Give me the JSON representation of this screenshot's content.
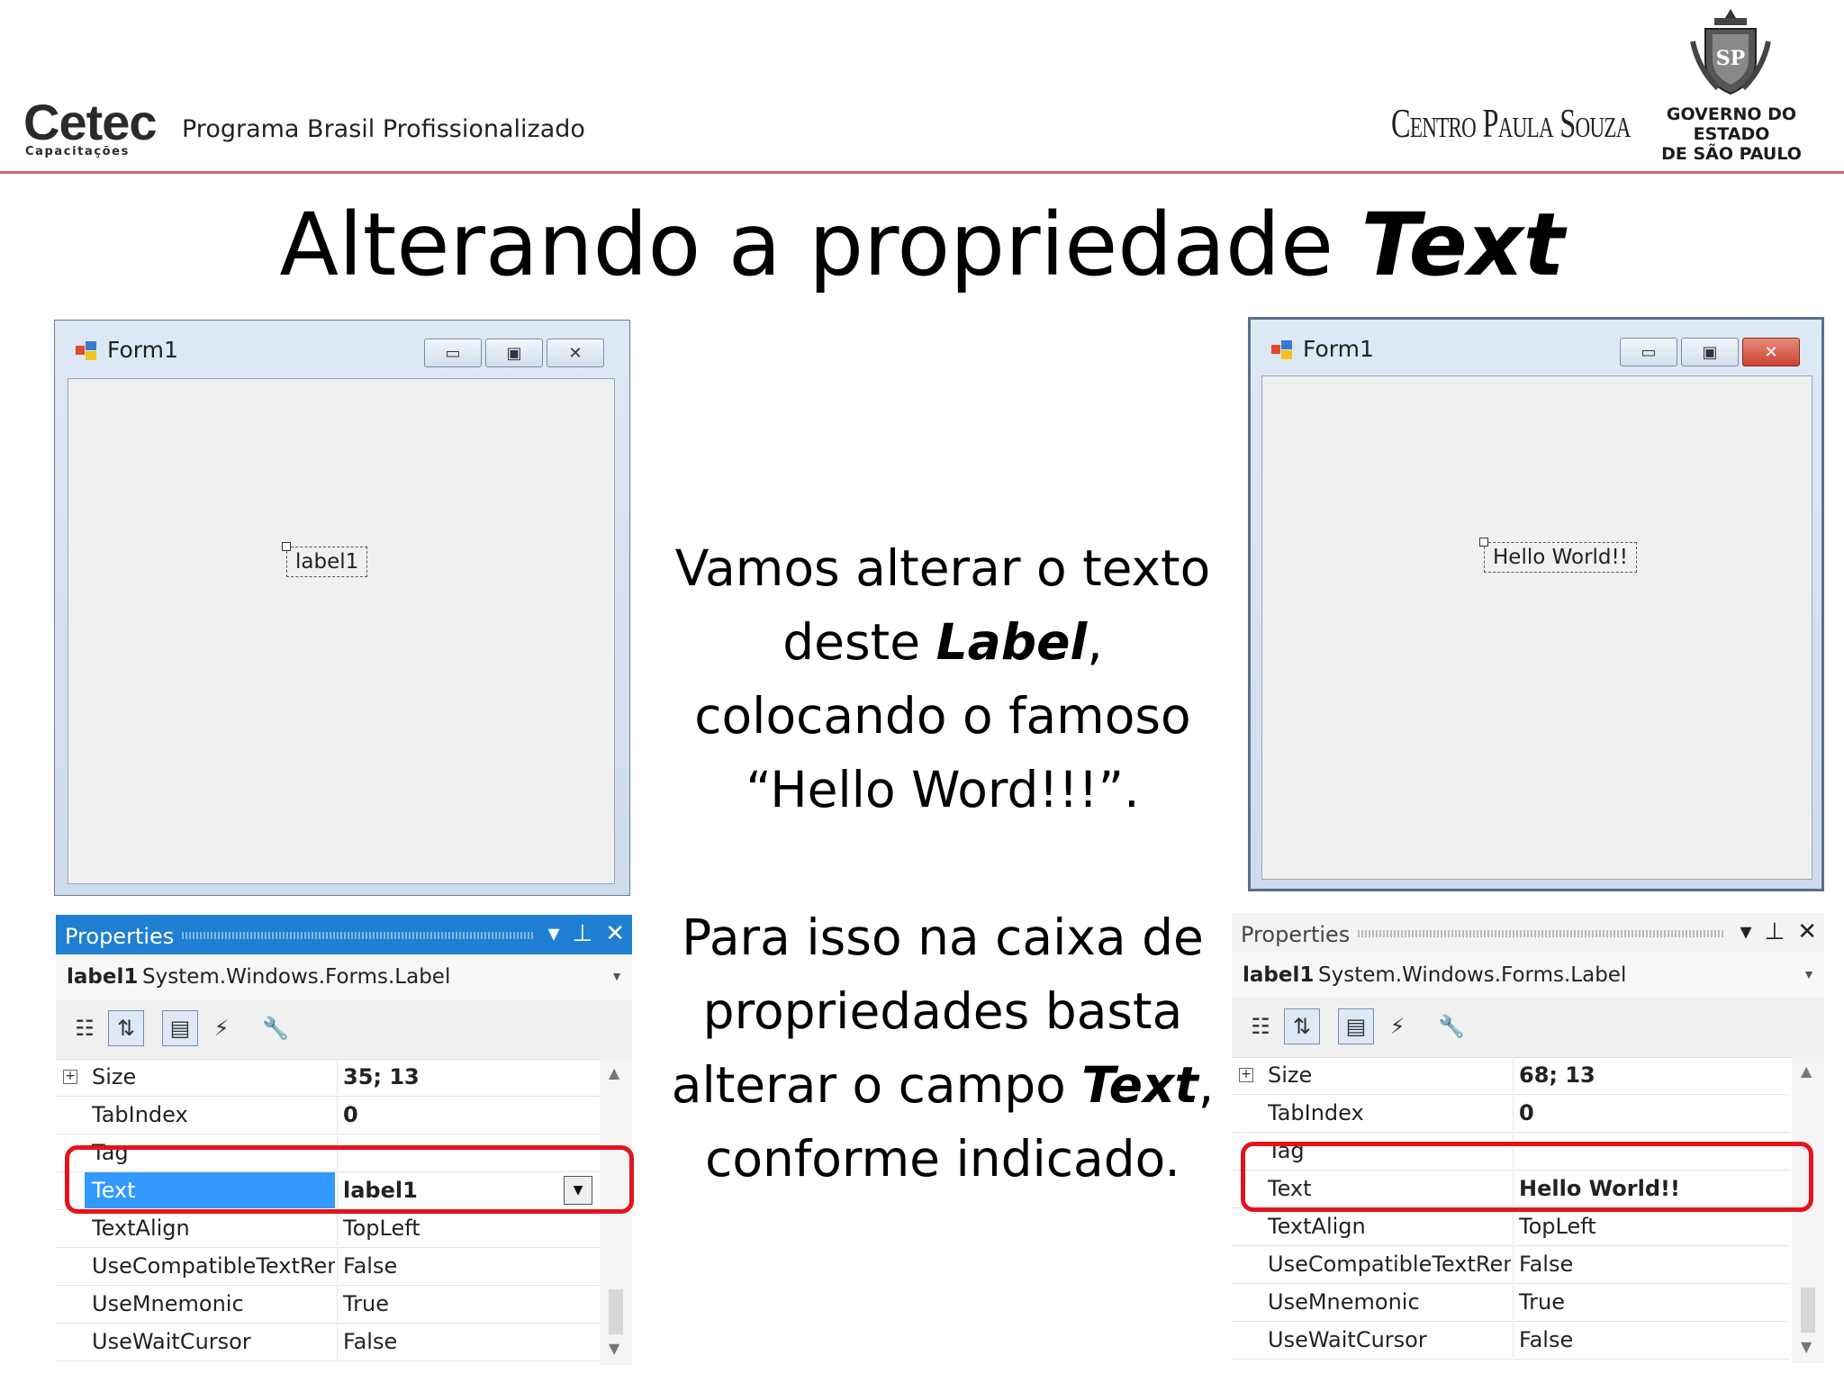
{
  "header": {
    "brand": "Cetec",
    "brand_sub": "Capacitações",
    "program": "Programa Brasil Profissionalizado",
    "cps": "Centro Paula Souza",
    "gov_line1": "GOVERNO DO ESTADO",
    "gov_line2": "DE SÃO PAULO",
    "crest_text": "SP"
  },
  "title": {
    "prefix": "Alterando a propriedade ",
    "emphasis": "Text"
  },
  "paragraph1": {
    "line1": "Vamos alterar o texto",
    "line2_pre": "deste ",
    "line2_em": "Label",
    "line2_post": ",",
    "line3": "colocando o famoso",
    "line4": "“Hello Word!!!”."
  },
  "paragraph2": {
    "line1": "Para isso na caixa de",
    "line2": "propriedades  basta",
    "line3_pre": "alterar o campo ",
    "line3_em": "Text",
    "line3_post": ",",
    "line4": "conforme indicado."
  },
  "form_left": {
    "title": "Form1",
    "btn_min": "▭",
    "btn_max": "▣",
    "btn_close": "✕",
    "label_text": "label1"
  },
  "form_right": {
    "title": "Form1",
    "btn_min": "▭",
    "btn_max": "▣",
    "btn_close": "✕",
    "label_text": "Hello World!!"
  },
  "props_left": {
    "header": "Properties",
    "tools": [
      "▾",
      "⊥",
      "✕"
    ],
    "object_name": "label1",
    "object_type": "System.Windows.Forms.Label",
    "rows": [
      {
        "name": "Size",
        "value": "35; 13"
      },
      {
        "name": "TabIndex",
        "value": "0"
      },
      {
        "name": "Tag",
        "value": ""
      },
      {
        "name": "Text",
        "value": "label1"
      },
      {
        "name": "TextAlign",
        "value": "TopLeft"
      },
      {
        "name": "UseCompatibleTextRen",
        "value": "False"
      },
      {
        "name": "UseMnemonic",
        "value": "True"
      },
      {
        "name": "UseWaitCursor",
        "value": "False"
      }
    ]
  },
  "props_right": {
    "header": "Properties",
    "tools": [
      "▾",
      "⊥",
      "✕"
    ],
    "object_name": "label1",
    "object_type": "System.Windows.Forms.Label",
    "rows": [
      {
        "name": "Size",
        "value": "68; 13"
      },
      {
        "name": "TabIndex",
        "value": "0"
      },
      {
        "name": "Tag",
        "value": ""
      },
      {
        "name": "Text",
        "value": "Hello World!!"
      },
      {
        "name": "TextAlign",
        "value": "TopLeft"
      },
      {
        "name": "UseCompatibleTextRen",
        "value": "False"
      },
      {
        "name": "UseMnemonic",
        "value": "True"
      },
      {
        "name": "UseWaitCursor",
        "value": "False"
      }
    ]
  },
  "colors": {
    "accent_red": "#e3141b",
    "header_rule": "#c0504d",
    "selection_blue": "#3399ff",
    "panel_active_blue": "#1f7fd2"
  }
}
